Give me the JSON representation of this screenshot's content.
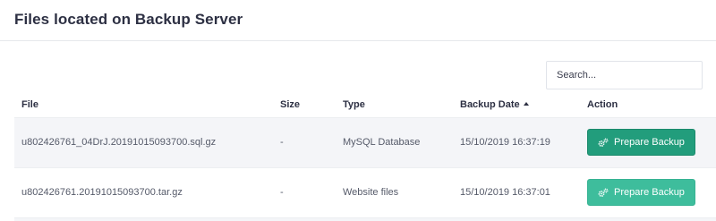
{
  "header": {
    "title": "Files located on Backup Server"
  },
  "search": {
    "placeholder": "Search..."
  },
  "table": {
    "columns": {
      "file": "File",
      "size": "Size",
      "type": "Type",
      "date": "Backup Date",
      "action": "Action"
    },
    "sort": {
      "column": "Backup Date",
      "direction": "asc"
    },
    "rows": [
      {
        "file": "u802426761_04DrJ.20191015093700.sql.gz",
        "size": "-",
        "type": "MySQL Database",
        "date": "15/10/2019 16:37:19",
        "action": "Prepare Backup"
      },
      {
        "file": "u802426761.20191015093700.tar.gz",
        "size": "-",
        "type": "Website files",
        "date": "15/10/2019 16:37:01",
        "action": "Prepare Backup"
      }
    ]
  },
  "colors": {
    "button_primary": "#229d7c",
    "button_hover_light": "#3ebd9c",
    "row_stripe": "#f4f5f8"
  },
  "icons": {
    "action": "gears-icon",
    "sort": "sort-caret-up-icon"
  }
}
